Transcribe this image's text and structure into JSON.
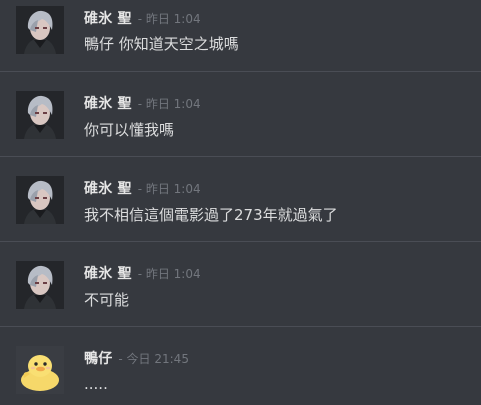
{
  "messages": [
    {
      "author": "碓氷 聖",
      "timestamp": "- 昨日 1:04",
      "text": "鴨仔 你知道天空之城嗎",
      "avatar": "anime-boy-avatar"
    },
    {
      "author": "碓氷 聖",
      "timestamp": "- 昨日 1:04",
      "text": "你可以懂我嗎",
      "avatar": "anime-boy-avatar"
    },
    {
      "author": "碓氷 聖",
      "timestamp": "- 昨日 1:04",
      "text": "我不相信這個電影過了273年就過氣了",
      "avatar": "anime-boy-avatar"
    },
    {
      "author": "碓氷 聖",
      "timestamp": "- 昨日 1:04",
      "text": "不可能",
      "avatar": "anime-boy-avatar"
    },
    {
      "author": "鴨仔",
      "timestamp": "- 今日 21:45",
      "text": ".....",
      "avatar": "yellow-duck-avatar"
    }
  ],
  "colors": {
    "background": "#36393f",
    "divider": "#4a4d55",
    "author": "#e6e6e6",
    "timestamp": "#72767d",
    "text": "#dcddde"
  }
}
